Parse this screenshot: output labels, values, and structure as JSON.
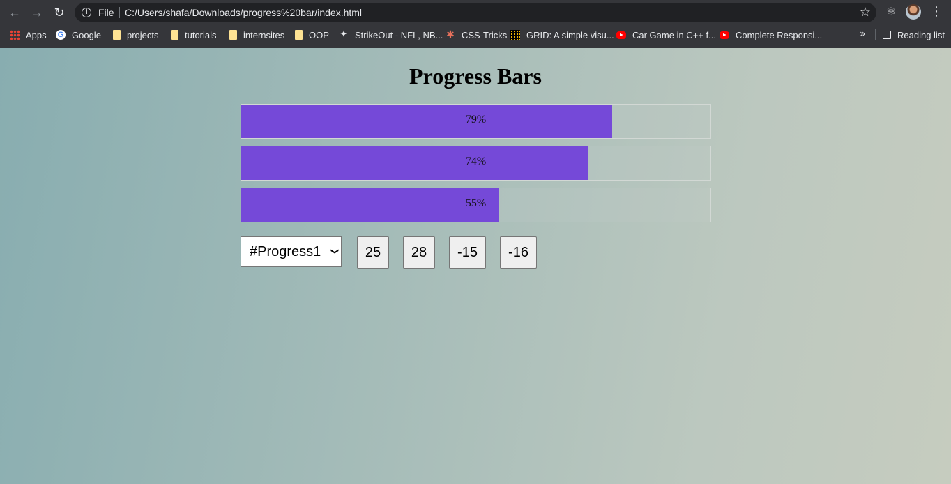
{
  "browser": {
    "back_icon": "arrow-left-icon",
    "forward_icon": "arrow-right-icon",
    "reload_icon": "reload-icon",
    "scheme_label": "File",
    "url": "C:/Users/shafa/Downloads/progress%20bar/index.html",
    "bookmarks": [
      {
        "label": "Apps",
        "icon": "apps-icon"
      },
      {
        "label": "Google",
        "icon": "google-icon"
      },
      {
        "label": "projects",
        "icon": "folder-icon"
      },
      {
        "label": "tutorials",
        "icon": "folder-icon"
      },
      {
        "label": "internsites",
        "icon": "folder-icon"
      },
      {
        "label": "OOP",
        "icon": "folder-icon"
      },
      {
        "label": "StrikeOut - NFL, NB...",
        "icon": "runner-icon"
      },
      {
        "label": "CSS-Tricks",
        "icon": "css-tricks-icon"
      },
      {
        "label": "GRID: A simple visu...",
        "icon": "grid-icon"
      },
      {
        "label": "Car Game in C++ f...",
        "icon": "youtube-icon"
      },
      {
        "label": "Complete Responsi...",
        "icon": "youtube-icon"
      }
    ],
    "reading_list_label": "Reading list"
  },
  "page": {
    "title": "Progress Bars",
    "accent_color": "#7549d8",
    "bars": [
      {
        "label": "79%",
        "value": 79
      },
      {
        "label": "74%",
        "value": 74
      },
      {
        "label": "55%",
        "value": 55
      }
    ],
    "select_value": "#Progress1",
    "buttons": [
      "25",
      "28",
      "-15",
      "-16"
    ]
  }
}
